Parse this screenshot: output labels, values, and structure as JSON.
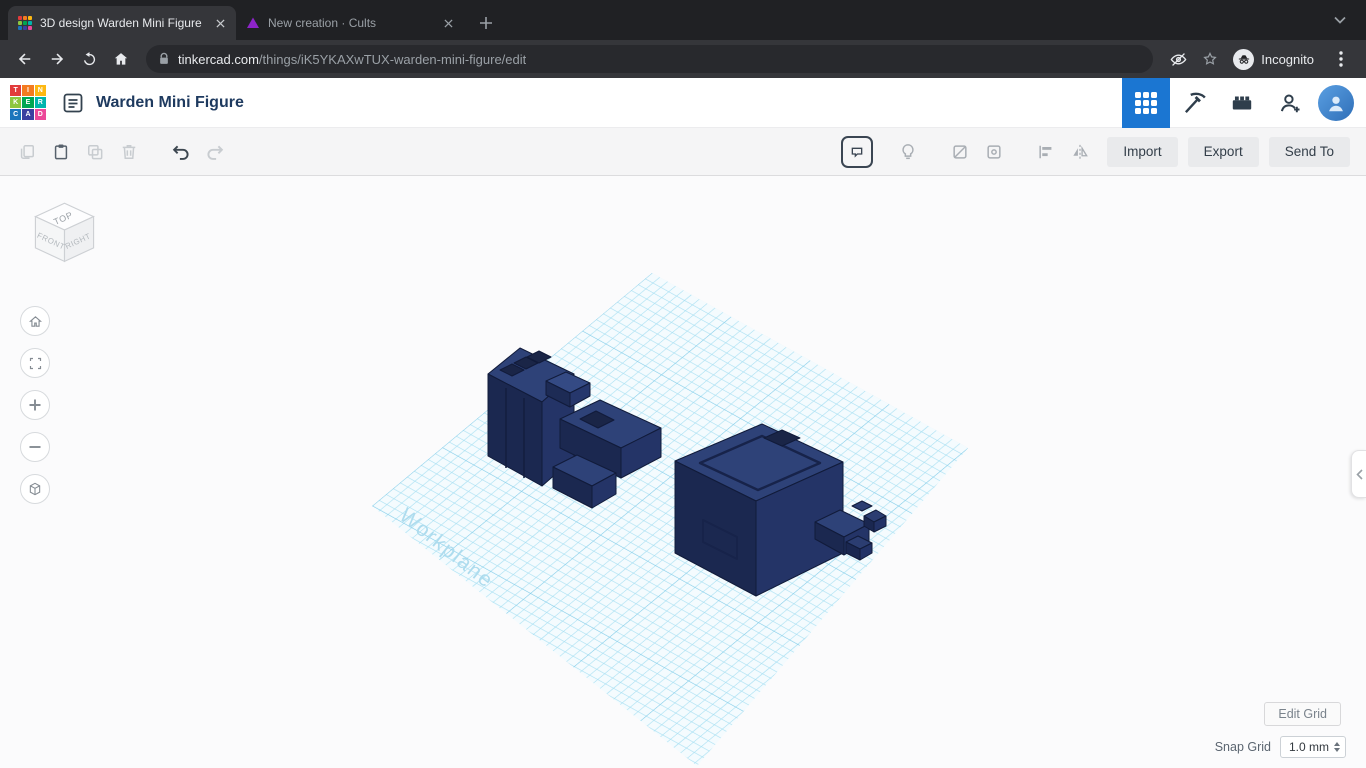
{
  "browser": {
    "tabs": [
      {
        "title": "3D design Warden Mini Figure"
      },
      {
        "title": "New creation · Cults"
      }
    ],
    "url": {
      "domain": "tinkercad.com",
      "path": "/things/iK5YKAXwTUX-warden-mini-figure/edit"
    },
    "incognito_label": "Incognito"
  },
  "header": {
    "logo_letters": [
      "T",
      "I",
      "N",
      "K",
      "E",
      "R",
      "C",
      "A",
      "D"
    ],
    "title": "Warden Mini Figure"
  },
  "toolbar": {
    "import_label": "Import",
    "export_label": "Export",
    "send_to_label": "Send To"
  },
  "viewport": {
    "viewcube": {
      "top": "TOP",
      "front": "FRONT",
      "right": "RIGHT"
    },
    "workplane_label": "Workplane",
    "edit_grid_label": "Edit Grid",
    "snap_grid_label": "Snap Grid",
    "snap_grid_value": "1.0 mm"
  },
  "colors": {
    "accent_blue": "#1b76d2",
    "workplane_grid": "#9fdbef",
    "model_navy": "#24356b",
    "chrome_dark": "#202124"
  }
}
